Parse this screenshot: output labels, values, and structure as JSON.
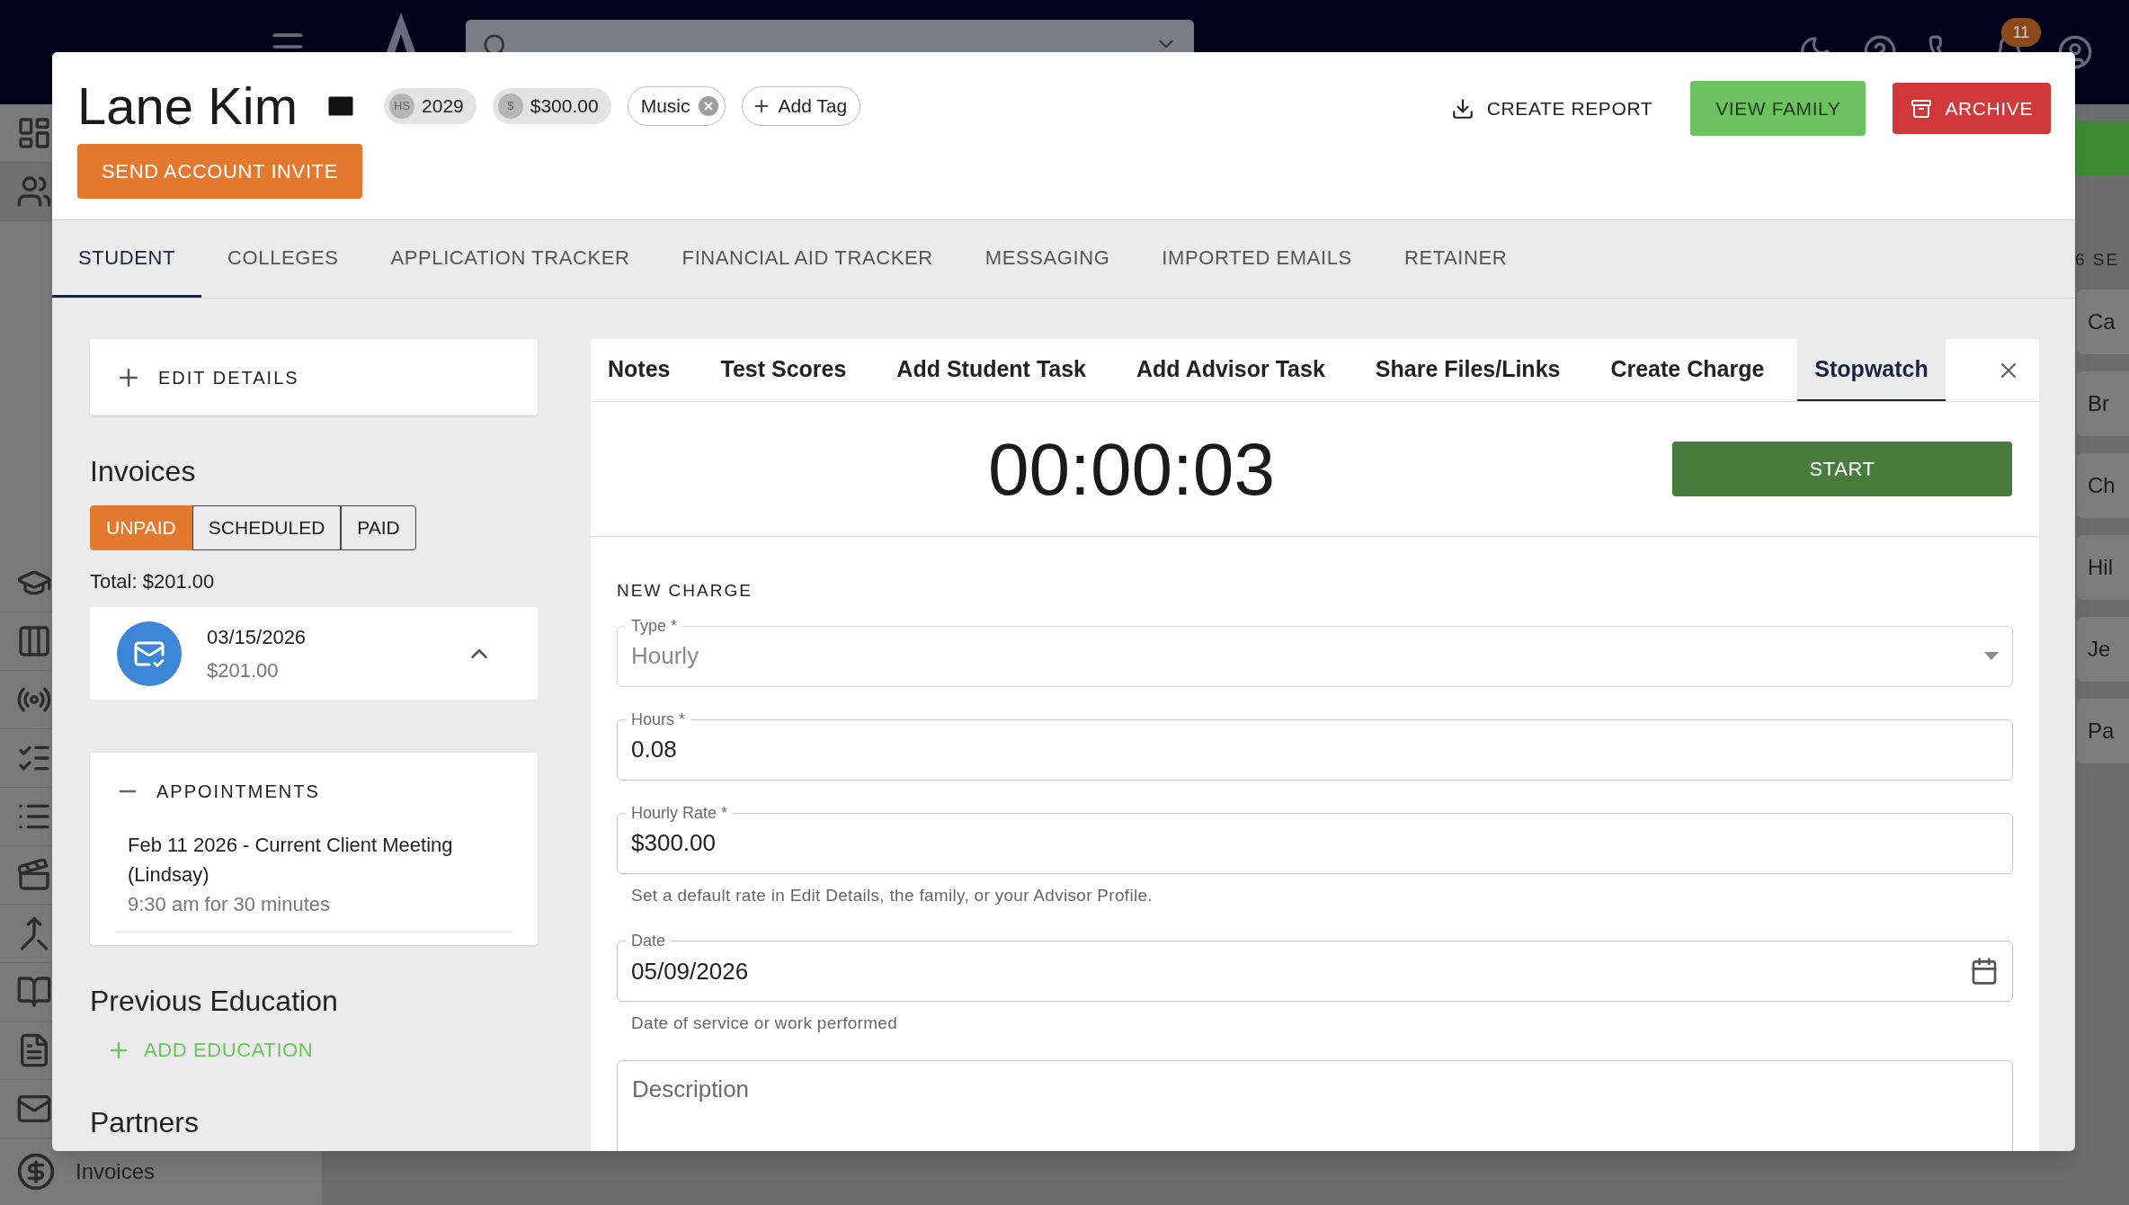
{
  "app_bar": {
    "notification_count": "11"
  },
  "sidebar": {
    "footer_item": "Invoices"
  },
  "side_panel": {
    "heading": "6 SE",
    "items": [
      "Ca",
      "Br",
      "Ch",
      "Hil",
      "Je",
      "Pa"
    ]
  },
  "profile": {
    "name": "Lane Kim",
    "chips": [
      {
        "kind": "badge",
        "badge": "HS",
        "label": "2029"
      },
      {
        "kind": "badge",
        "badge": "$",
        "label": "$300.00"
      },
      {
        "kind": "tag",
        "label": "Music"
      },
      {
        "kind": "add",
        "label": "Add Tag"
      }
    ],
    "send_invite": "SEND ACCOUNT INVITE",
    "actions": [
      {
        "kind": "report",
        "label": "CREATE REPORT"
      },
      {
        "kind": "family",
        "label": "VIEW FAMILY"
      },
      {
        "kind": "archive",
        "label": "ARCHIVE"
      }
    ]
  },
  "tabs": [
    {
      "label": "STUDENT",
      "selected": true
    },
    {
      "label": "COLLEGES",
      "selected": false
    },
    {
      "label": "APPLICATION TRACKER",
      "selected": false
    },
    {
      "label": "FINANCIAL AID TRACKER",
      "selected": false
    },
    {
      "label": "MESSAGING",
      "selected": false
    },
    {
      "label": "IMPORTED EMAILS",
      "selected": false
    },
    {
      "label": "RETAINER",
      "selected": false
    }
  ],
  "left": {
    "edit_details": "EDIT DETAILS",
    "invoices": {
      "heading": "Invoices",
      "filters": [
        {
          "label": "UNPAID",
          "selected": true
        },
        {
          "label": "SCHEDULED",
          "selected": false
        },
        {
          "label": "PAID",
          "selected": false
        }
      ],
      "total": "Total: $201.00",
      "items": [
        {
          "date": "03/15/2026",
          "amount": "$201.00",
          "expanded": true
        }
      ]
    },
    "appointments": {
      "title": "APPOINTMENTS",
      "expanded": true,
      "items": [
        {
          "title": "Feb 11 2026 - Current Client Meeting (Lindsay)",
          "time": "9:30 am for 30 minutes"
        }
      ]
    },
    "previous_education": {
      "heading": "Previous Education",
      "add": "ADD EDUCATION"
    },
    "partners": {
      "heading": "Partners"
    }
  },
  "panel": {
    "tabs": [
      {
        "label": "Notes",
        "selected": false
      },
      {
        "label": "Test Scores",
        "selected": false
      },
      {
        "label": "Add Student Task",
        "selected": false
      },
      {
        "label": "Add Advisor Task",
        "selected": false
      },
      {
        "label": "Share Files/Links",
        "selected": false
      },
      {
        "label": "Create Charge",
        "selected": false
      },
      {
        "label": "Stopwatch",
        "selected": true
      }
    ],
    "stopwatch": {
      "time": "00:00:03",
      "button": "START"
    },
    "charge": {
      "heading": "NEW CHARGE",
      "fields": [
        {
          "kind": "select",
          "label": "Type *",
          "value": "Hourly",
          "disabled": true
        },
        {
          "kind": "text",
          "label": "Hours *",
          "value": "0.08",
          "disabled": false
        },
        {
          "kind": "text",
          "label": "Hourly Rate *",
          "value": "$300.00",
          "disabled": false,
          "helper": "Set a default rate in Edit Details, the family, or your Advisor Profile."
        },
        {
          "kind": "date",
          "label": "Date",
          "value": "05/09/2026",
          "disabled": false,
          "helper": "Date of service or work performed"
        },
        {
          "kind": "textarea",
          "placeholder": "Description",
          "disabled": false
        }
      ]
    }
  }
}
